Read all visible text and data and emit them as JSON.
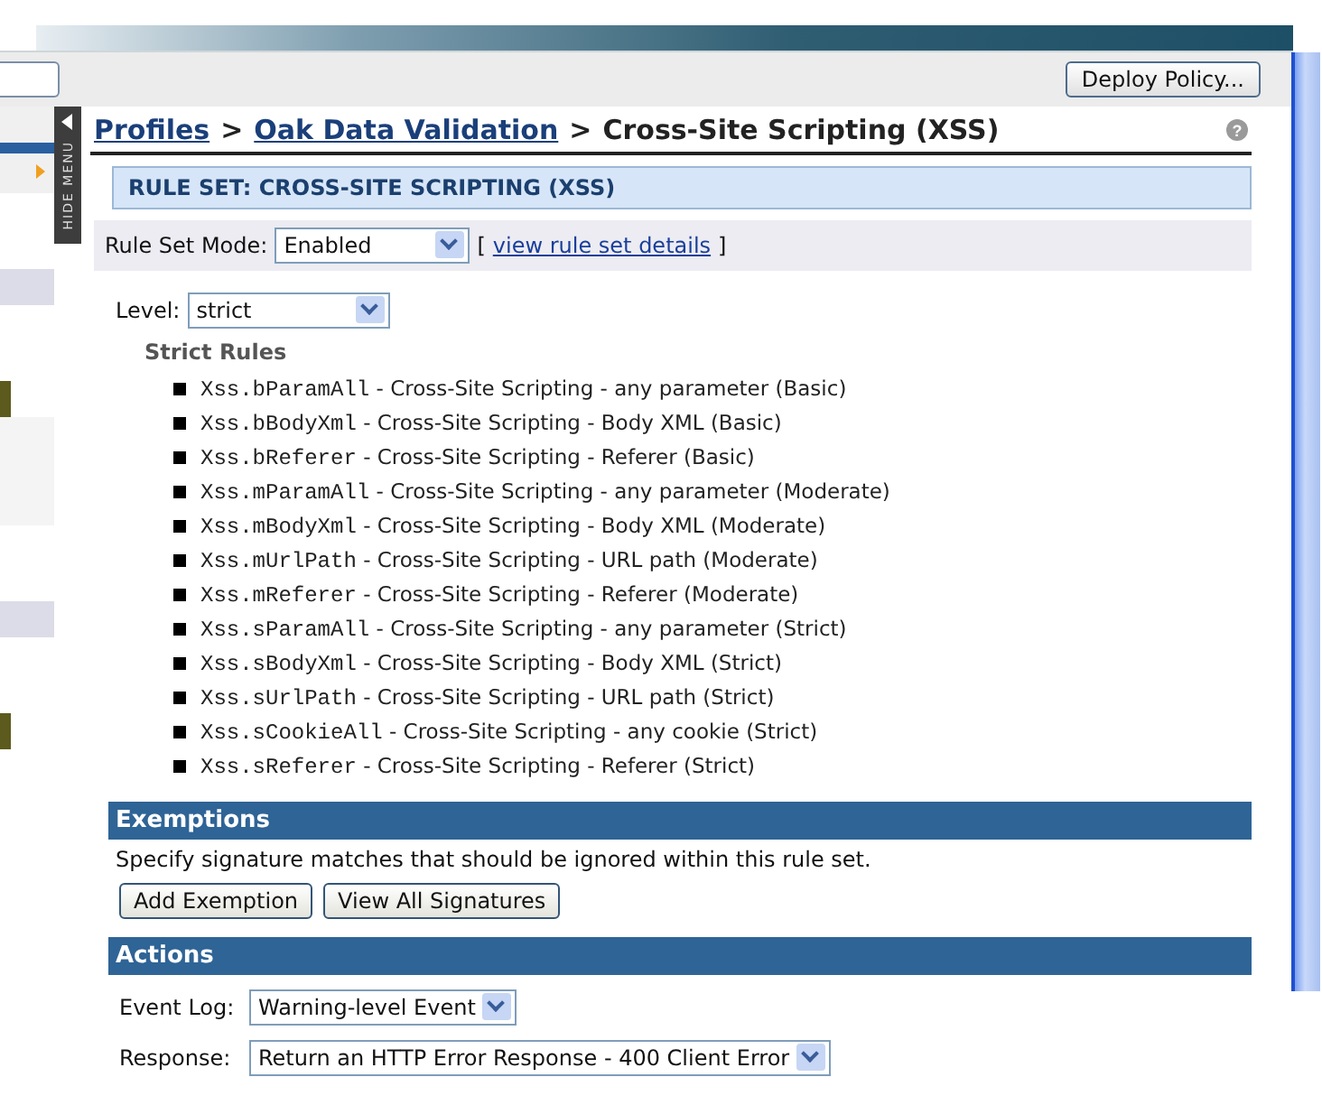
{
  "toolbar": {
    "deploy_button": "Deploy Policy..."
  },
  "hide_menu": {
    "label": "HIDE MENU"
  },
  "help": "?",
  "breadcrumb": {
    "separator": ">",
    "items": [
      {
        "text": "Profiles",
        "link": true
      },
      {
        "text": "Oak Data Validation",
        "link": true
      },
      {
        "text": "Cross-Site Scripting (XSS)",
        "link": false
      }
    ]
  },
  "rule_set": {
    "title": "RULE SET: CROSS-SITE SCRIPTING (XSS)",
    "mode_label": "Rule Set Mode:",
    "mode_value": "Enabled",
    "open_bracket": "[",
    "details_link": "view rule set details",
    "close_bracket": "]"
  },
  "level": {
    "label": "Level:",
    "value": "strict"
  },
  "rules_heading": "Strict Rules",
  "rules": [
    {
      "code": "Xss.bParamAll",
      "text": "- Cross-Site Scripting - any parameter (Basic)"
    },
    {
      "code": "Xss.bBodyXml",
      "text": "- Cross-Site Scripting - Body XML (Basic)"
    },
    {
      "code": "Xss.bReferer",
      "text": "- Cross-Site Scripting - Referer (Basic)"
    },
    {
      "code": "Xss.mParamAll",
      "text": "- Cross-Site Scripting - any parameter (Moderate)"
    },
    {
      "code": "Xss.mBodyXml",
      "text": "- Cross-Site Scripting - Body XML (Moderate)"
    },
    {
      "code": "Xss.mUrlPath",
      "text": "- Cross-Site Scripting - URL path (Moderate)"
    },
    {
      "code": "Xss.mReferer",
      "text": "- Cross-Site Scripting - Referer (Moderate)"
    },
    {
      "code": "Xss.sParamAll",
      "text": "- Cross-Site Scripting - any parameter (Strict)"
    },
    {
      "code": "Xss.sBodyXml",
      "text": "- Cross-Site Scripting - Body XML (Strict)"
    },
    {
      "code": "Xss.sUrlPath",
      "text": "- Cross-Site Scripting - URL path (Strict)"
    },
    {
      "code": "Xss.sCookieAll",
      "text": "- Cross-Site Scripting - any cookie (Strict)"
    },
    {
      "code": "Xss.sReferer",
      "text": "- Cross-Site Scripting - Referer (Strict)"
    }
  ],
  "exemptions": {
    "title": "Exemptions",
    "text": "Specify signature matches that should be ignored within this rule set.",
    "buttons": [
      "Add Exemption",
      "View All Signatures"
    ]
  },
  "actions": {
    "title": "Actions",
    "fields": [
      {
        "label": "Event Log:",
        "value": "Warning-level Event"
      },
      {
        "label": "Response:",
        "value": "Return an HTTP Error Response - 400 Client Error"
      }
    ]
  }
}
